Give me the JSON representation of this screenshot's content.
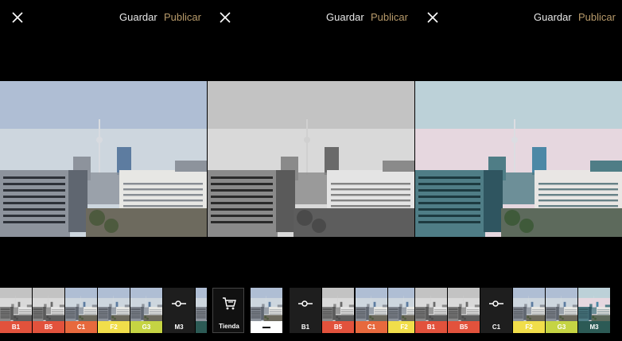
{
  "panels": [
    {
      "id": "p1",
      "save_label": "Guardar",
      "publish_label": "Publicar",
      "tone": "color",
      "filters": [
        {
          "label": "B1",
          "color": "#e2523c",
          "tone": "gray",
          "kind": "filter"
        },
        {
          "label": "B5",
          "color": "#e2523c",
          "tone": "gray",
          "kind": "filter"
        },
        {
          "label": "C1",
          "color": "#e7693d",
          "tone": "color",
          "kind": "filter"
        },
        {
          "label": "F2",
          "color": "#f1de4a",
          "tone": "color",
          "kind": "filter"
        },
        {
          "label": "G3",
          "color": "#c5d443",
          "tone": "color",
          "kind": "filter"
        },
        {
          "label": "M3",
          "color": "#1e1e1e",
          "tone": "none",
          "kind": "tool"
        },
        {
          "label": "",
          "color": "#2c5a55",
          "tone": "color",
          "kind": "filter"
        }
      ]
    },
    {
      "id": "p2",
      "save_label": "Guardar",
      "publish_label": "Publicar",
      "tone": "gray",
      "filters": [
        {
          "label": "Tienda",
          "color": "#111111",
          "tone": "none",
          "kind": "shop"
        },
        {
          "label": "",
          "color": "#ffffff",
          "tone": "color",
          "kind": "original"
        },
        {
          "label": "B1",
          "color": "#1e1e1e",
          "tone": "none",
          "kind": "tool"
        },
        {
          "label": "B5",
          "color": "#e2523c",
          "tone": "gray",
          "kind": "filter"
        },
        {
          "label": "C1",
          "color": "#e7693d",
          "tone": "color",
          "kind": "filter"
        },
        {
          "label": "F2",
          "color": "#f1de4a",
          "tone": "color",
          "kind": "filter"
        }
      ]
    },
    {
      "id": "p3",
      "save_label": "Guardar",
      "publish_label": "Publicar",
      "tone": "teal",
      "filters": [
        {
          "label": "B1",
          "color": "#e2523c",
          "tone": "gray",
          "kind": "filter"
        },
        {
          "label": "B5",
          "color": "#e2523c",
          "tone": "gray",
          "kind": "filter"
        },
        {
          "label": "C1",
          "color": "#1e1e1e",
          "tone": "none",
          "kind": "tool"
        },
        {
          "label": "F2",
          "color": "#f1de4a",
          "tone": "color",
          "kind": "filter"
        },
        {
          "label": "G3",
          "color": "#c5d443",
          "tone": "color",
          "kind": "filter"
        },
        {
          "label": "M3",
          "color": "#2c5a55",
          "tone": "teal",
          "kind": "filter"
        }
      ]
    }
  ],
  "colors": {
    "publish": "#b79a6a",
    "save": "#e8e8e8",
    "background": "#000000"
  },
  "icons": {
    "close": "close-icon",
    "adjust": "slider-adjust-icon",
    "shop": "shopping-cart-icon"
  }
}
